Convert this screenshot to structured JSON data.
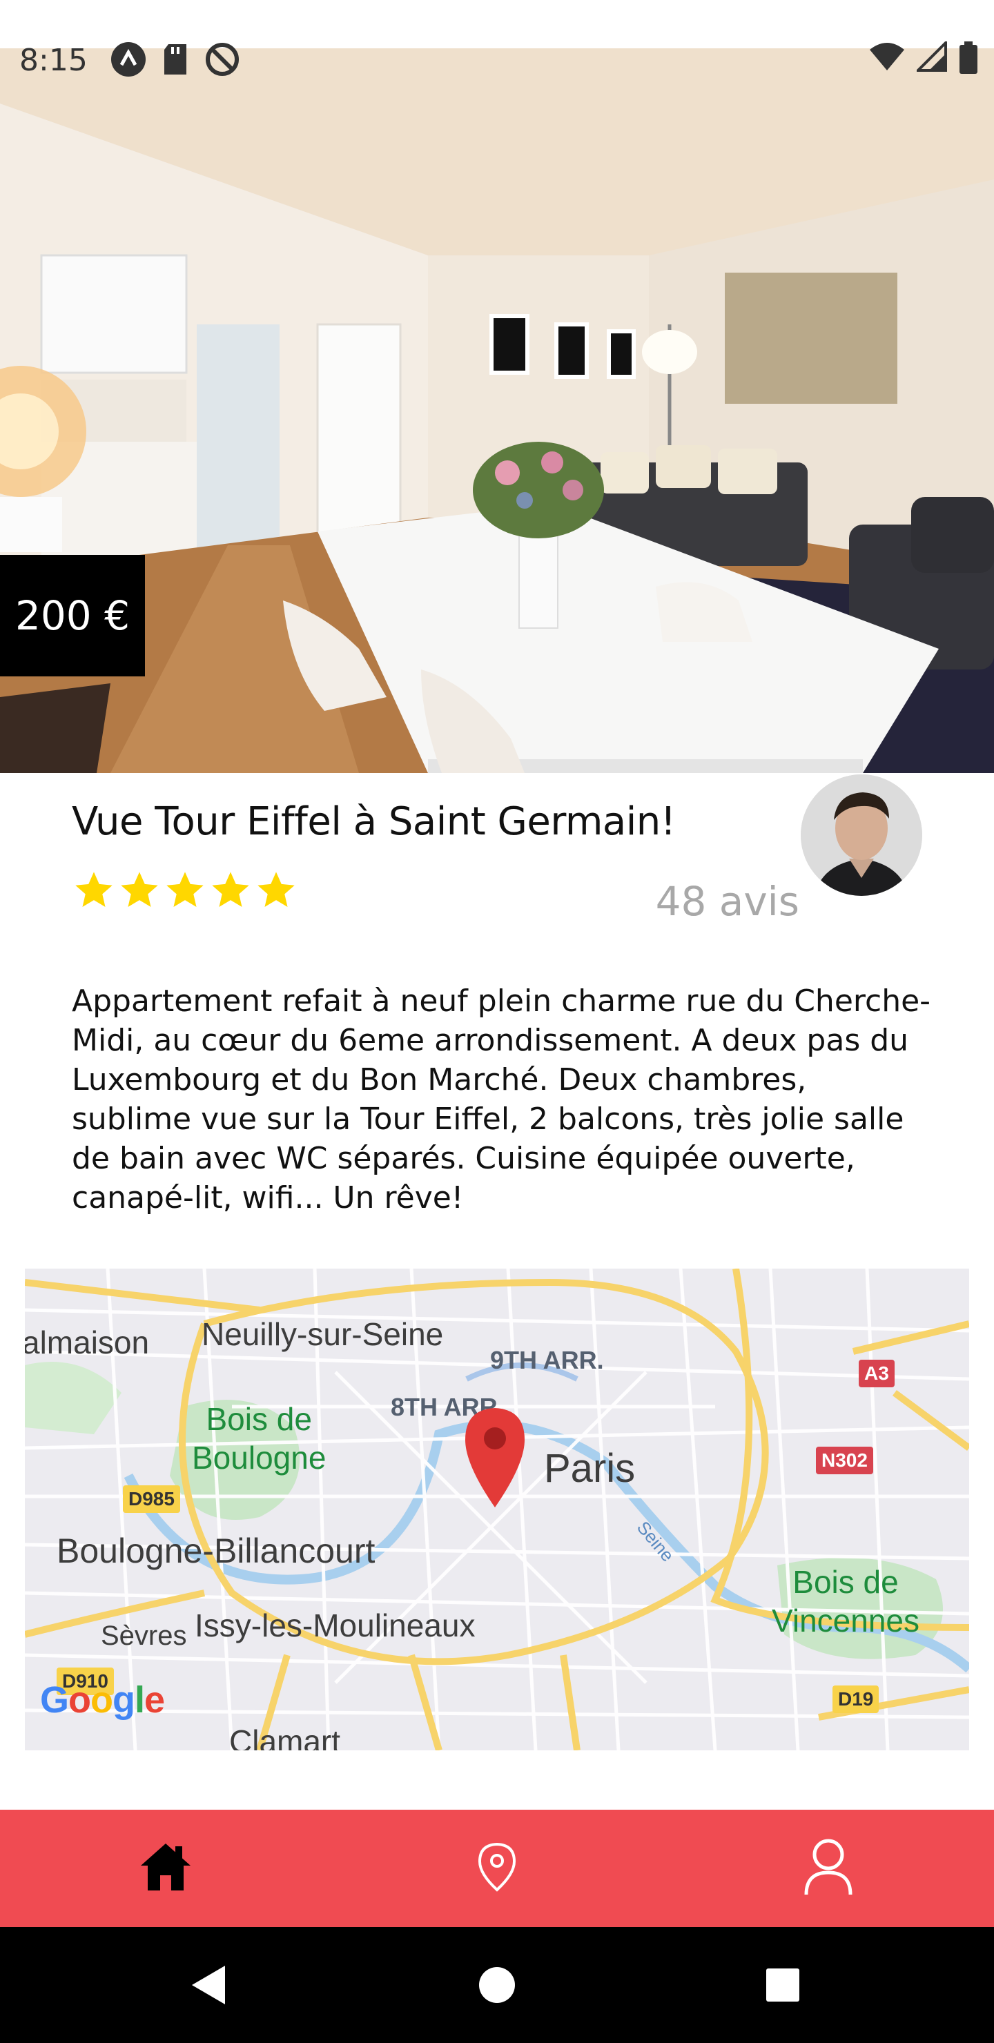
{
  "status_bar": {
    "time": "8:15",
    "left_icons": [
      "notification-icon",
      "sd-card-icon",
      "blocked-icon"
    ],
    "right_icons": [
      "wifi-icon",
      "signal-icon",
      "battery-icon"
    ]
  },
  "listing": {
    "price": "200 €",
    "title": "Vue Tour Eiffel à Saint Germain!",
    "rating": 5,
    "rating_max": 5,
    "reviews_label": "48 avis",
    "description": "Appartement refait à neuf plein charme rue du Cherche-Midi, au cœur du 6eme arrondissement. A deux pas du Luxembourg et du Bon Marché. Deux chambres, sublime vue sur la Tour Eiffel, 2 balcons, très jolie salle de bain avec WC séparés. Cuisine équipée ouverte, canapé-lit, wifi... Un rêve!"
  },
  "map": {
    "labels": {
      "malmaison": "almaison",
      "neuilly": "Neuilly-sur-Seine",
      "arr9": "9TH ARR.",
      "arr8": "8TH ARR",
      "bois_boulogne": "Bois de\nBoulogne",
      "paris": "Paris",
      "seine": "Seine",
      "boulogne": "Boulogne-Billancourt",
      "sevres": "Sèvres",
      "issy": "Issy-les-Moulineaux",
      "bois_vincennes": "Bois de\nVincennes",
      "clamart": "Clamart",
      "google": "Google"
    },
    "road_badges": {
      "a3": "A3",
      "n302": "N302",
      "d985": "D985",
      "d910": "D910",
      "d19": "D19"
    }
  },
  "bottom_nav": {
    "items": [
      "home-icon",
      "location-pin-icon",
      "user-icon"
    ],
    "active": "home-icon"
  },
  "android_nav": [
    "back-button",
    "home-button",
    "recents-button"
  ],
  "colors": {
    "accent": "#f04b52",
    "star": "#ffd700",
    "price_bg": "#000000",
    "reviews_text": "#a8a8a8",
    "map_pin": "#e33a38"
  }
}
